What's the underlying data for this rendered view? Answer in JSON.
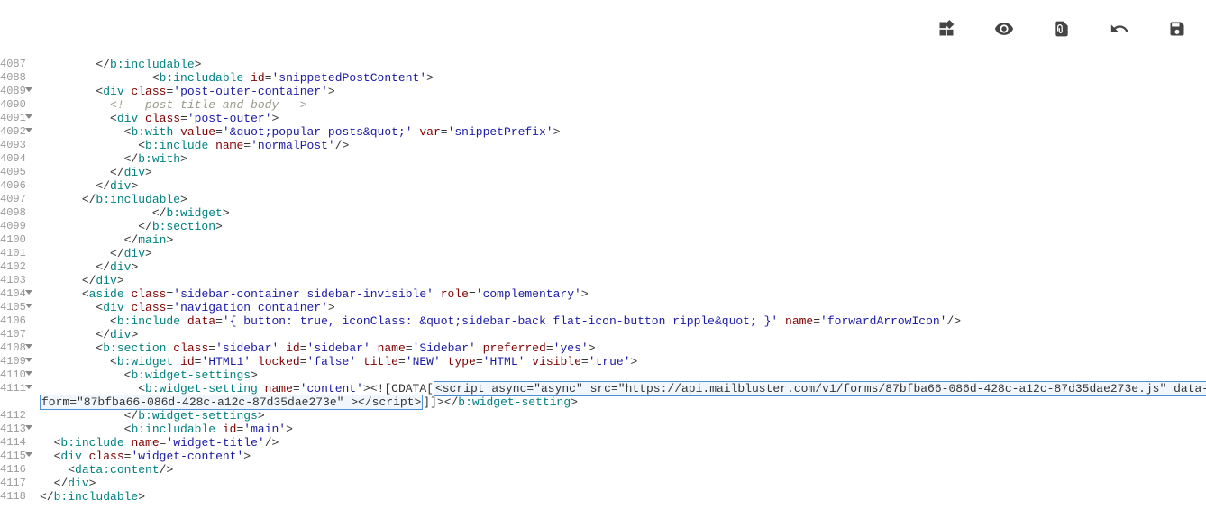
{
  "toolbar": {
    "icons": [
      "widgets-icon",
      "preview-icon",
      "revert-icon",
      "undo-icon",
      "save-icon"
    ]
  },
  "lines": [
    {
      "n": "4087",
      "fold": false,
      "indent": 8,
      "html": "<span class='punct'>&lt;/</span><span class='tag'>b:includable</span><span class='punct'>&gt;</span>"
    },
    {
      "n": "4088",
      "fold": false,
      "indent": 16,
      "html": "<span class='punct'>&lt;</span><span class='tag'>b:includable</span> <span class='attr-name'>id</span><span class='punct'>=</span><span class='string'>'snippetedPostContent'</span><span class='punct'>&gt;</span>"
    },
    {
      "n": "4089",
      "fold": true,
      "indent": 8,
      "html": "<span class='punct'>&lt;</span><span class='tag'>div</span> <span class='attr-name'>class</span><span class='punct'>=</span><span class='string'>'post-outer-container'</span><span class='punct'>&gt;</span>"
    },
    {
      "n": "4090",
      "fold": false,
      "indent": 10,
      "html": "<span class='comment'>&lt;!-- post title and body --&gt;</span>"
    },
    {
      "n": "4091",
      "fold": true,
      "indent": 10,
      "html": "<span class='punct'>&lt;</span><span class='tag'>div</span> <span class='attr-name'>class</span><span class='punct'>=</span><span class='string'>'post-outer'</span><span class='punct'>&gt;</span>"
    },
    {
      "n": "4092",
      "fold": true,
      "indent": 12,
      "html": "<span class='punct'>&lt;</span><span class='tag'>b:with</span> <span class='attr-name'>value</span><span class='punct'>=</span><span class='string'>'&amp;quot;popular-posts&amp;quot;'</span> <span class='attr-name'>var</span><span class='punct'>=</span><span class='string'>'snippetPrefix'</span><span class='punct'>&gt;</span>"
    },
    {
      "n": "4093",
      "fold": false,
      "indent": 14,
      "html": "<span class='punct'>&lt;</span><span class='tag'>b:include</span> <span class='attr-name'>name</span><span class='punct'>=</span><span class='string'>'normalPost'</span><span class='punct'>/&gt;</span>"
    },
    {
      "n": "4094",
      "fold": false,
      "indent": 12,
      "html": "<span class='punct'>&lt;/</span><span class='tag'>b:with</span><span class='punct'>&gt;</span>"
    },
    {
      "n": "4095",
      "fold": false,
      "indent": 10,
      "html": "<span class='punct'>&lt;/</span><span class='tag'>div</span><span class='punct'>&gt;</span>"
    },
    {
      "n": "4096",
      "fold": false,
      "indent": 8,
      "html": "<span class='punct'>&lt;/</span><span class='tag'>div</span><span class='punct'>&gt;</span>"
    },
    {
      "n": "4097",
      "fold": false,
      "indent": 6,
      "html": "<span class='punct'>&lt;/</span><span class='tag'>b:includable</span><span class='punct'>&gt;</span>"
    },
    {
      "n": "4098",
      "fold": false,
      "indent": 16,
      "html": "<span class='punct'>&lt;/</span><span class='tag'>b:widget</span><span class='punct'>&gt;</span>"
    },
    {
      "n": "4099",
      "fold": false,
      "indent": 14,
      "html": "<span class='punct'>&lt;/</span><span class='tag'>b:section</span><span class='punct'>&gt;</span>"
    },
    {
      "n": "4100",
      "fold": false,
      "indent": 12,
      "html": "<span class='punct'>&lt;/</span><span class='tag'>main</span><span class='punct'>&gt;</span>"
    },
    {
      "n": "4101",
      "fold": false,
      "indent": 10,
      "html": "<span class='punct'>&lt;/</span><span class='tag'>div</span><span class='punct'>&gt;</span>"
    },
    {
      "n": "4102",
      "fold": false,
      "indent": 8,
      "html": "<span class='punct'>&lt;/</span><span class='tag'>div</span><span class='punct'>&gt;</span>"
    },
    {
      "n": "4103",
      "fold": false,
      "indent": 6,
      "html": "<span class='punct'>&lt;/</span><span class='tag'>div</span><span class='punct'>&gt;</span>"
    },
    {
      "n": "4104",
      "fold": true,
      "indent": 6,
      "html": "<span class='punct'>&lt;</span><span class='tag'>aside</span> <span class='attr-name'>class</span><span class='punct'>=</span><span class='string'>'sidebar-container sidebar-invisible'</span> <span class='attr-name'>role</span><span class='punct'>=</span><span class='string'>'complementary'</span><span class='punct'>&gt;</span>"
    },
    {
      "n": "4105",
      "fold": true,
      "indent": 8,
      "html": "<span class='punct'>&lt;</span><span class='tag'>div</span> <span class='attr-name'>class</span><span class='punct'>=</span><span class='string'>'navigation container'</span><span class='punct'>&gt;</span>"
    },
    {
      "n": "4106",
      "fold": false,
      "indent": 10,
      "html": "<span class='punct'>&lt;</span><span class='tag'>b:include</span> <span class='attr-name'>data</span><span class='punct'>=</span><span class='string'>'{ button: true, iconClass: &amp;quot;sidebar-back flat-icon-button ripple&amp;quot; }'</span> <span class='attr-name'>name</span><span class='punct'>=</span><span class='string'>'forwardArrowIcon'</span><span class='punct'>/&gt;</span>"
    },
    {
      "n": "4107",
      "fold": false,
      "indent": 8,
      "html": "<span class='punct'>&lt;/</span><span class='tag'>div</span><span class='punct'>&gt;</span>"
    },
    {
      "n": "4108",
      "fold": true,
      "indent": 8,
      "html": "<span class='punct'>&lt;</span><span class='tag'>b:section</span> <span class='attr-name'>class</span><span class='punct'>=</span><span class='string'>'sidebar'</span> <span class='attr-name'>id</span><span class='punct'>=</span><span class='string'>'sidebar'</span> <span class='attr-name'>name</span><span class='punct'>=</span><span class='string'>'Sidebar'</span> <span class='attr-name'>preferred</span><span class='punct'>=</span><span class='string'>'yes'</span><span class='punct'>&gt;</span>"
    },
    {
      "n": "4109",
      "fold": true,
      "indent": 10,
      "html": "<span class='punct'>&lt;</span><span class='tag'>b:widget</span> <span class='attr-name'>id</span><span class='punct'>=</span><span class='string'>'HTML1'</span> <span class='attr-name'>locked</span><span class='punct'>=</span><span class='string'>'false'</span> <span class='attr-name'>title</span><span class='punct'>=</span><span class='string'>'NEW'</span> <span class='attr-name'>type</span><span class='punct'>=</span><span class='string'>'HTML'</span> <span class='attr-name'>visible</span><span class='punct'>=</span><span class='string'>'true'</span><span class='punct'>&gt;</span>"
    },
    {
      "n": "4110",
      "fold": true,
      "indent": 12,
      "html": "<span class='punct'>&lt;</span><span class='tag'>b:widget-settings</span><span class='punct'>&gt;</span>"
    },
    {
      "n": "4111",
      "fold": true,
      "indent": 14,
      "html": "<span class='punct'>&lt;</span><span class='tag'>b:widget-setting</span> <span class='attr-name'>name</span><span class='punct'>=</span><span class='string'>'content'</span><span class='punct'>&gt;</span><span class='cdata-text'>&lt;![CDATA[</span><span class='highlight-box'>&lt;script async=&quot;async&quot; src=&quot;https://api.mailbluster.com/v1/forms/87bfba66-086d-428c-a12c-87d35dae273e.js&quot; data-</span>"
    },
    {
      "n": "",
      "fold": false,
      "indent": 0,
      "html": "<span class='highlight-box'>form=&quot;87bfba66-086d-428c-a12c-87d35dae273e&quot; &gt;&lt;/script&gt;</span><span class='cdata-text'>]]&gt;</span><span class='punct'>&lt;/</span><span class='tag'>b:widget-setting</span><span class='punct'>&gt;</span>"
    },
    {
      "n": "4112",
      "fold": false,
      "indent": 12,
      "html": "<span class='punct'>&lt;/</span><span class='tag'>b:widget-settings</span><span class='punct'>&gt;</span>"
    },
    {
      "n": "4113",
      "fold": true,
      "indent": 12,
      "html": "<span class='punct'>&lt;</span><span class='tag'>b:includable</span> <span class='attr-name'>id</span><span class='punct'>=</span><span class='string'>'main'</span><span class='punct'>&gt;</span>"
    },
    {
      "n": "4114",
      "fold": false,
      "indent": 2,
      "html": "<span class='punct'>&lt;</span><span class='tag'>b:include</span> <span class='attr-name'>name</span><span class='punct'>=</span><span class='string'>'widget-title'</span><span class='punct'>/&gt;</span>"
    },
    {
      "n": "4115",
      "fold": true,
      "indent": 2,
      "html": "<span class='punct'>&lt;</span><span class='tag'>div</span> <span class='attr-name'>class</span><span class='punct'>=</span><span class='string'>'widget-content'</span><span class='punct'>&gt;</span>"
    },
    {
      "n": "4116",
      "fold": false,
      "indent": 4,
      "html": "<span class='punct'>&lt;</span><span class='tag'>data:content</span><span class='punct'>/&gt;</span>"
    },
    {
      "n": "4117",
      "fold": false,
      "indent": 2,
      "html": "<span class='punct'>&lt;/</span><span class='tag'>div</span><span class='punct'>&gt;</span>"
    },
    {
      "n": "4118",
      "fold": false,
      "indent": 0,
      "html": "<span class='punct'>&lt;/</span><span class='tag'>b:includable</span><span class='punct'>&gt;</span>"
    }
  ]
}
